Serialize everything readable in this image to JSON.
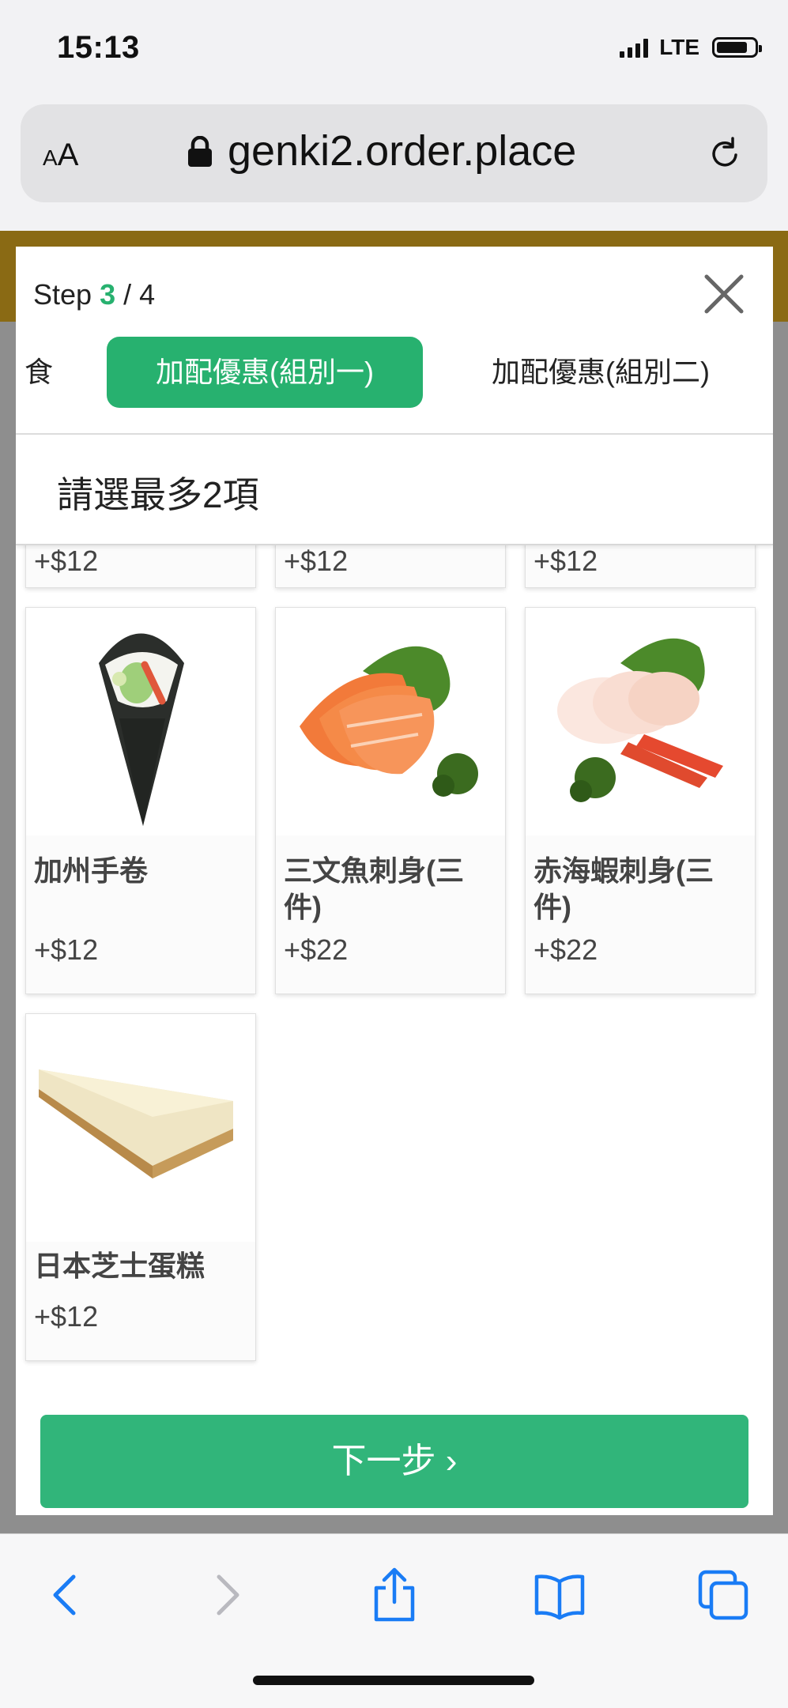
{
  "status_bar": {
    "time": "15:13",
    "network": "LTE"
  },
  "browser": {
    "text_size_label": "AA",
    "url": "genki2.order.place"
  },
  "modal": {
    "step_prefix": "Step",
    "step_current": "3",
    "step_separator": "/",
    "step_total": "4",
    "tabs": [
      {
        "label": "食",
        "active": false
      },
      {
        "label": "加配優惠(組別一)",
        "active": true
      },
      {
        "label": "加配優惠(組別二)",
        "active": false
      }
    ],
    "instruction": "請選最多2項",
    "partial_row_prices": [
      "+$12",
      "+$12",
      "+$12"
    ],
    "items": [
      {
        "name": "加州手卷",
        "price": "+$12",
        "image": "temaki-hand-roll"
      },
      {
        "name": "三文魚刺身(三件)",
        "price": "+$22",
        "image": "salmon-sashimi"
      },
      {
        "name": "赤海蝦刺身(三件)",
        "price": "+$22",
        "image": "red-shrimp-sashimi"
      },
      {
        "name": "日本芝士蛋糕",
        "price": "+$12",
        "image": "cheesecake"
      }
    ],
    "next_button": "下一步 ›"
  },
  "colors": {
    "accent": "#27b16f",
    "brand_gold": "#8a6a14",
    "ios_blue": "#1a7cf5"
  }
}
